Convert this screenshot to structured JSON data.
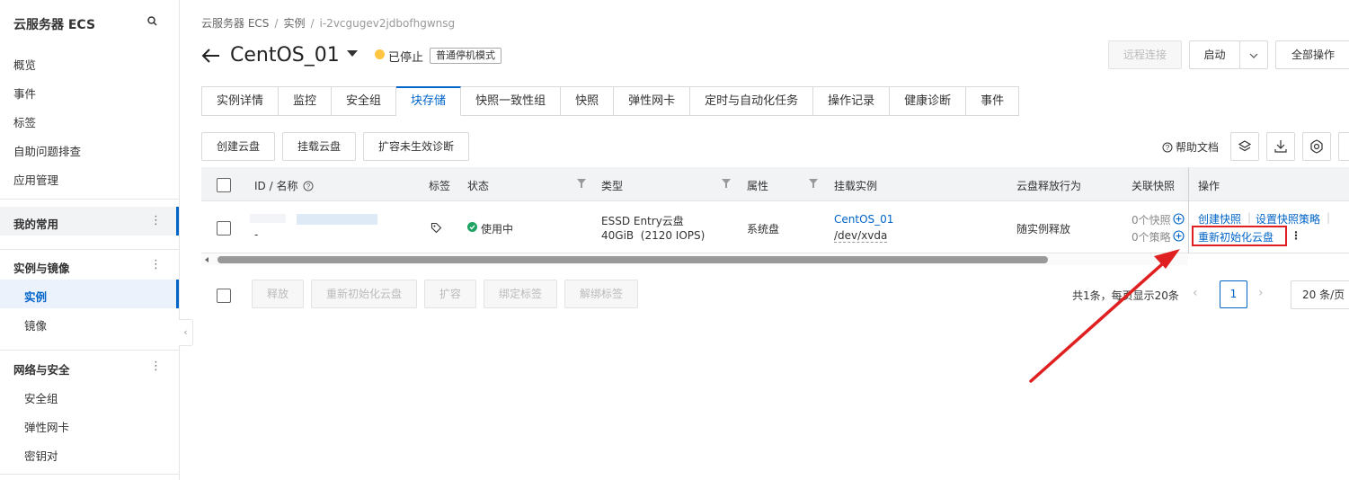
{
  "sidebar": {
    "title": "云服务器 ECS",
    "items": [
      "概览",
      "事件",
      "标签",
      "自助问题排查",
      "应用管理"
    ],
    "favorites_label": "我的常用",
    "groups": [
      {
        "label": "实例与镜像",
        "items": [
          "实例",
          "镜像"
        ]
      },
      {
        "label": "网络与安全",
        "items": [
          "安全组",
          "弹性网卡",
          "密钥对"
        ]
      }
    ],
    "collapse_glyph": "‹"
  },
  "breadcrumb": [
    "云服务器 ECS",
    "实例",
    "i-2vcgugev2jdbofhgwnsg"
  ],
  "breadcrumb_sep": "/",
  "header": {
    "title": "CentOS_01",
    "status": "已停止",
    "stop_mode": "普通停机模式",
    "status_color": "#ffc440"
  },
  "actions": {
    "remote": "远程连接",
    "start": "启动",
    "all_ops": "全部操作"
  },
  "tabs": [
    "实例详情",
    "监控",
    "安全组",
    "块存储",
    "快照一致性组",
    "快照",
    "弹性网卡",
    "定时与自动化任务",
    "操作记录",
    "健康诊断",
    "事件"
  ],
  "active_tab": "块存储",
  "toolbar": {
    "create_disk": "创建云盘",
    "attach_disk": "挂载云盘",
    "resize_diag": "扩容未生效诊断",
    "help": "帮助文档"
  },
  "table": {
    "headers": [
      "ID / 名称",
      "标签",
      "状态",
      "类型",
      "属性",
      "挂载实例",
      "云盘释放行为",
      "关联快照",
      "操作"
    ],
    "row": {
      "name": "-",
      "status": "使用中",
      "type_line1": "ESSD Entry云盘",
      "type_line2": "40GiB  (2120 IOPS)",
      "attribute": "系统盘",
      "instance": "CentOS_01",
      "device": "/dev/xvda",
      "release": "随实例释放",
      "snapshots": "0个快照",
      "policies": "0个策略",
      "op_create_snapshot": "创建快照",
      "op_set_policy": "设置快照策略",
      "op_reinit": "重新初始化云盘",
      "op_sep": "|",
      "op_more": "⋮"
    }
  },
  "footer": {
    "release": "释放",
    "reinit": "重新初始化云盘",
    "resize": "扩容",
    "bind_tag": "绑定标签",
    "unbind_tag": "解绑标签",
    "total": "共1条，每页显示20条",
    "prev": "‹",
    "page": "1",
    "next": "›",
    "page_size": "20 条/页"
  },
  "colors": {
    "accent": "#0064c8",
    "success": "#1ea361",
    "highlight": "#e02020"
  }
}
